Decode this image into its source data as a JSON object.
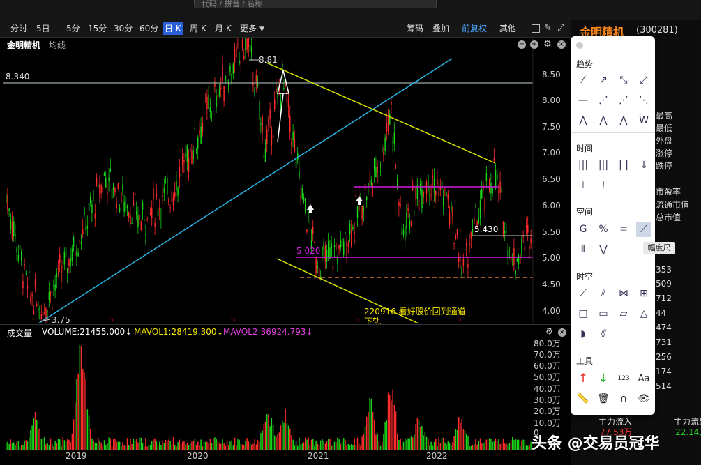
{
  "search": {
    "placeholder": "代码 / 拼音 / 名称"
  },
  "periods": [
    "分时",
    "5日",
    "5分",
    "15分",
    "30分",
    "60分",
    "日 K",
    "周 K",
    "月 K",
    "更多"
  ],
  "active_period": "日 K",
  "toolbar": {
    "chips": "筹码",
    "overlay": "叠加",
    "adjust": "前复权",
    "other": "其他"
  },
  "chart": {
    "stock_name": "金明精机",
    "indicator": "均线",
    "hline_label": "8.340",
    "high_label": "8.81",
    "low_label": "3.75",
    "price_5430": "5.430",
    "price_5020": "5.020",
    "annotation_line1": "220916 看好股价回到通道",
    "annotation_line2": "下轨",
    "s_marker": "S"
  },
  "chart_data": {
    "type": "candlestick",
    "ylabel": "",
    "y_ticks": [
      "8.50",
      "8.00",
      "7.50",
      "7.00",
      "6.50",
      "6.00",
      "5.50",
      "5.00",
      "4.50",
      "4.00"
    ],
    "x_ticks": [
      "2019",
      "2020",
      "2021",
      "2022"
    ],
    "horizontal_levels": [
      8.34,
      5.43,
      5.02,
      4.62
    ],
    "high": 8.81,
    "low": 3.75
  },
  "volume": {
    "title": "成交量",
    "volume": "VOLUME:21455.000↓",
    "mavol1": "MAVOL1:28419.300↓",
    "mavol2": "MAVOL2:36924.793↓",
    "ticks": [
      "80.0万",
      "70.0万",
      "60.0万",
      "50.0万",
      "40.0万",
      "30.0万",
      "20.0万",
      "10.0万",
      "0"
    ]
  },
  "right": {
    "name": "金明精机",
    "code": "(300281)",
    "labels": [
      "最高",
      "最低",
      "外盘",
      "涨停",
      "跌停"
    ],
    "metrics": [
      "市盈率",
      "流通市值",
      "总市值"
    ],
    "nums": [
      "353",
      "509",
      "712",
      "44",
      "474",
      "731",
      "256",
      "174",
      "514"
    ],
    "inflow": "主力流入",
    "inflow_val": "77.53万",
    "outflow": "主力流出",
    "outflow_val": "22.14万"
  },
  "popup": {
    "sec_trend": "趋势",
    "sec_time": "时间",
    "sec_space": "空间",
    "sec_spacetime": "时空",
    "sec_tools": "工具",
    "tooltip": "幅度尺",
    "text_tool": "Aa",
    "num_tool": "123"
  },
  "watermark": "头条 @交易员冠华"
}
